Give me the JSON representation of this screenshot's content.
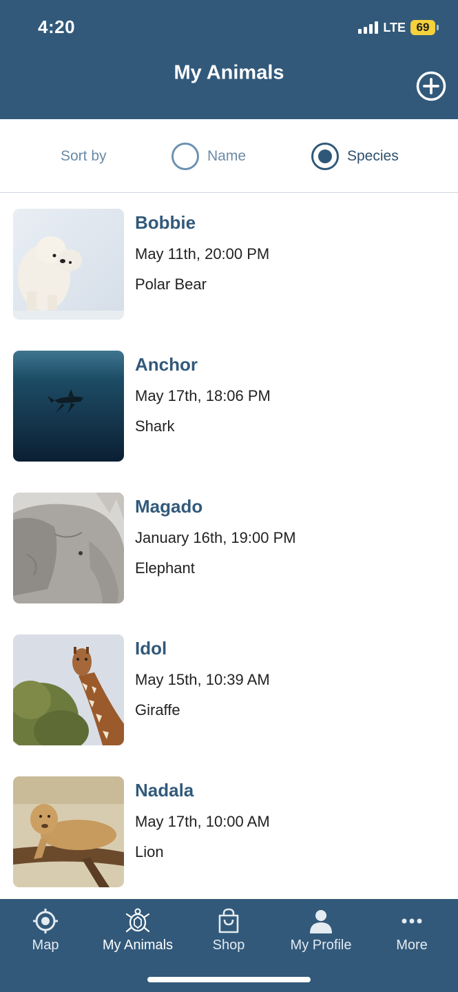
{
  "status": {
    "time": "4:20",
    "network": "LTE",
    "battery": "69"
  },
  "header": {
    "title": "My Animals",
    "add_icon": "plus-circle-icon"
  },
  "sort": {
    "label": "Sort by",
    "options": [
      {
        "label": "Name",
        "selected": false
      },
      {
        "label": "Species",
        "selected": true
      }
    ]
  },
  "animals": [
    {
      "name": "Bobbie",
      "date": "May 11th, 20:00 PM",
      "species": "Polar Bear"
    },
    {
      "name": "Anchor",
      "date": "May 17th, 18:06 PM",
      "species": "Shark"
    },
    {
      "name": "Magado",
      "date": "January 16th, 19:00 PM",
      "species": "Elephant"
    },
    {
      "name": "Idol",
      "date": "May 15th, 10:39 AM",
      "species": "Giraffe"
    },
    {
      "name": "Nadala",
      "date": "May 17th, 10:00 AM",
      "species": "Lion"
    }
  ],
  "tabs": [
    {
      "label": "Map",
      "icon": "location-target-icon"
    },
    {
      "label": "My Animals",
      "icon": "turtle-icon"
    },
    {
      "label": "Shop",
      "icon": "shopping-bag-icon"
    },
    {
      "label": "My Profile",
      "icon": "user-icon"
    },
    {
      "label": "More",
      "icon": "more-dots-icon"
    }
  ],
  "colors": {
    "primary": "#32597a",
    "battery": "#f5d13b",
    "accent_text": "#6a8aa6"
  }
}
